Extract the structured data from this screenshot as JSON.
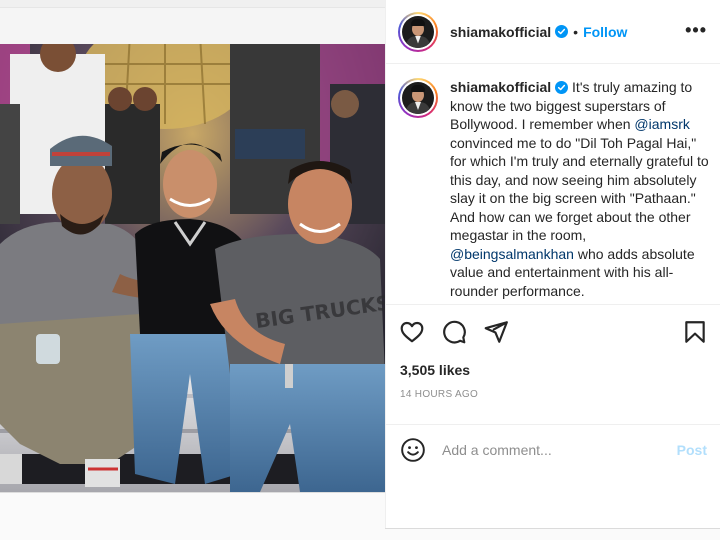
{
  "post": {
    "username": "shiamakofficial",
    "follow_label": "Follow",
    "more_label": "•••",
    "caption_username": "shiamakofficial",
    "caption_parts": [
      {
        "type": "text",
        "text": " It's truly amazing to know the two biggest superstars of Bollywood. I remember when "
      },
      {
        "type": "mention",
        "text": "@iamsrk"
      },
      {
        "type": "text",
        "text": " convinced me to do \"Dil Toh Pagal Hai,\" for which I'm truly and eternally grateful to this day, and now seeing him absolutely slay it on the big screen with \"Pathaan.\" And how can we forget about the other megastar in the room, "
      },
      {
        "type": "mention",
        "text": "@beingsalmankhan"
      },
      {
        "type": "text",
        "text": " who adds absolute value and entertainment with his all-rounder performance."
      }
    ],
    "likes": "3,505 likes",
    "timestamp": "14 HOURS AGO",
    "comment_placeholder": "Add a comment...",
    "post_label": "Post"
  },
  "icons": {
    "verified": "verified-badge-icon",
    "like": "heart-icon",
    "comment": "comment-icon",
    "share": "share-icon",
    "save": "bookmark-icon",
    "emoji": "emoji-icon"
  },
  "colors": {
    "link": "#0095f6",
    "mention": "#00376b",
    "muted": "#8e8e8e",
    "post_disabled": "#b2dffc"
  },
  "photo": {
    "shirt_print": "BIG TRUCKS"
  }
}
